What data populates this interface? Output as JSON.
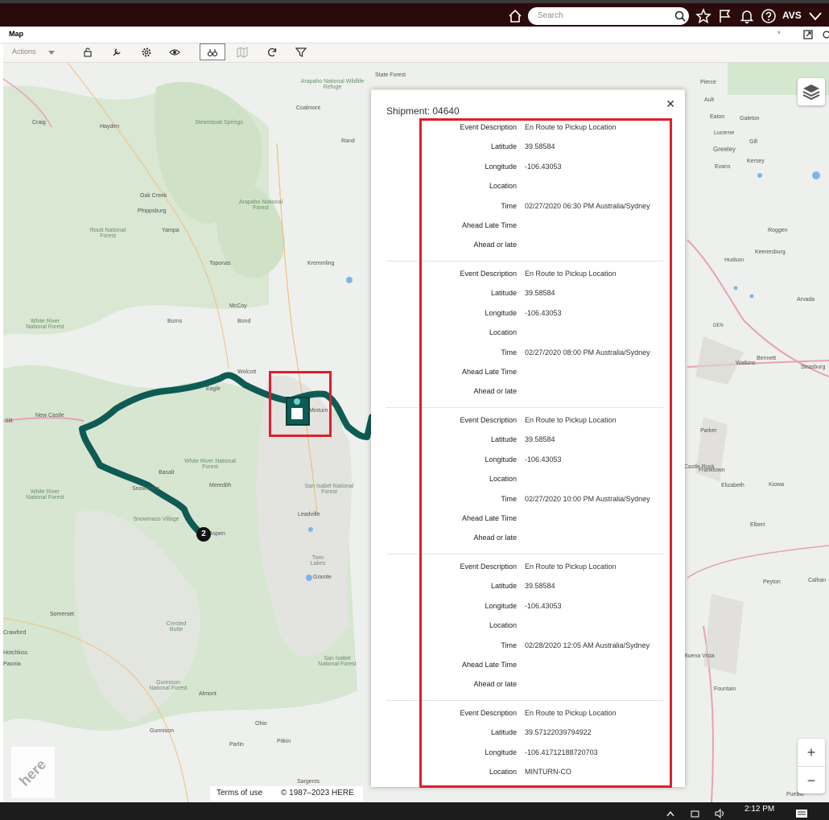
{
  "topbar": {
    "search_placeholder": "Search",
    "user": "AVS"
  },
  "window": {
    "title": "Map"
  },
  "toolbar": {
    "actions_label": "Actions"
  },
  "map": {
    "places": [
      "State Forest",
      "Arapaho National Wildlife Refuge",
      "Pierce",
      "Ault",
      "Craig",
      "Hayden",
      "Steamboat Springs",
      "Coalmont",
      "Eaton",
      "Galeton",
      "Lucerne",
      "Gill",
      "Greeley",
      "Rand",
      "Evans",
      "Kersey",
      "Oak Creek",
      "Phippsburg",
      "Routt National Forest",
      "Arapaho National Forest",
      "Yampa",
      "Roggen",
      "Hudson",
      "Keenesburg",
      "Toponas",
      "Kremmling",
      "McCoy",
      "Bond",
      "Burns",
      "White River National Forest",
      "DEN",
      "Bennett",
      "Watkins",
      "Strasburg",
      "Wolcott",
      "Eagle",
      "New Castle",
      "Silt",
      "Minturn",
      "Parker",
      "Basalt",
      "Snowmass",
      "White River National Forest",
      "Meredith",
      "Castle Rock",
      "Franktown",
      "Elizabeth",
      "Kiowa",
      "San Isabel National Forest",
      "Leadville",
      "Snowmass Village",
      "Aspen",
      "Elbert",
      "Twin Lakes",
      "Granite",
      "Peyton",
      "Calhan",
      "Somerset",
      "Crested Butte",
      "Gunnison National Forest",
      "Almont",
      "San Isabel National Forest",
      "Buena Vista",
      "Fountain",
      "Ohio",
      "Pitkin",
      "Gunnison",
      "Parlin",
      "Sargents",
      "Pueblo",
      "White River National Forest",
      "Crawford",
      "Hotchkiss",
      "Paonia",
      "Arvada"
    ]
  },
  "shipment": {
    "title": "Shipment: 04640",
    "records": [
      {
        "event_description_label": "Event Description",
        "event_description": "En Route to Pickup Location",
        "latitude_label": "Latitude",
        "latitude": "39.58584",
        "longitude_label": "Longitude",
        "longitude": "-106.43053",
        "location_label": "Location",
        "location": "",
        "time_label": "Time",
        "time": "02/27/2020 06:30 PM Australia/Sydney",
        "ahead_late_time_label": "Ahead Late Time",
        "ahead_late_time": "",
        "ahead_or_late_label": "Ahead or late",
        "ahead_or_late": ""
      },
      {
        "event_description_label": "Event Description",
        "event_description": "En Route to Pickup Location",
        "latitude_label": "Latitude",
        "latitude": "39.58584",
        "longitude_label": "Longitude",
        "longitude": "-106.43053",
        "location_label": "Location",
        "location": "",
        "time_label": "Time",
        "time": "02/27/2020 08:00 PM Australia/Sydney",
        "ahead_late_time_label": "Ahead Late Time",
        "ahead_late_time": "",
        "ahead_or_late_label": "Ahead or late",
        "ahead_or_late": ""
      },
      {
        "event_description_label": "Event Description",
        "event_description": "En Route to Pickup Location",
        "latitude_label": "Latitude",
        "latitude": "39.58584",
        "longitude_label": "Longitude",
        "longitude": "-106.43053",
        "location_label": "Location",
        "location": "",
        "time_label": "Time",
        "time": "02/27/2020 10:00 PM Australia/Sydney",
        "ahead_late_time_label": "Ahead Late Time",
        "ahead_late_time": "",
        "ahead_or_late_label": "Ahead or late",
        "ahead_or_late": ""
      },
      {
        "event_description_label": "Event Description",
        "event_description": "En Route to Pickup Location",
        "latitude_label": "Latitude",
        "latitude": "39.58584",
        "longitude_label": "Longitude",
        "longitude": "-106.43053",
        "location_label": "Location",
        "location": "",
        "time_label": "Time",
        "time": "02/28/2020 12:05 AM Australia/Sydney",
        "ahead_late_time_label": "Ahead Late Time",
        "ahead_late_time": "",
        "ahead_or_late_label": "Ahead or late",
        "ahead_or_late": ""
      },
      {
        "event_description_label": "Event Description",
        "event_description": "En Route to Pickup Location",
        "latitude_label": "Latitude",
        "latitude": "39.57122039794922",
        "longitude_label": "Longitude",
        "longitude": "-106.41712188720703",
        "location_label": "Location",
        "location": "MINTURN-CO"
      }
    ]
  },
  "cluster_marker": {
    "count": "2"
  },
  "footer": {
    "terms": "Terms of use",
    "copyright": "© 1987–2023 HERE",
    "brand": "here"
  },
  "taskbar": {
    "clock": "2:12 PM"
  },
  "colors": {
    "route": "#0e5b54",
    "highlight": "#e01e2b",
    "topbar": "#2b0a0d"
  }
}
